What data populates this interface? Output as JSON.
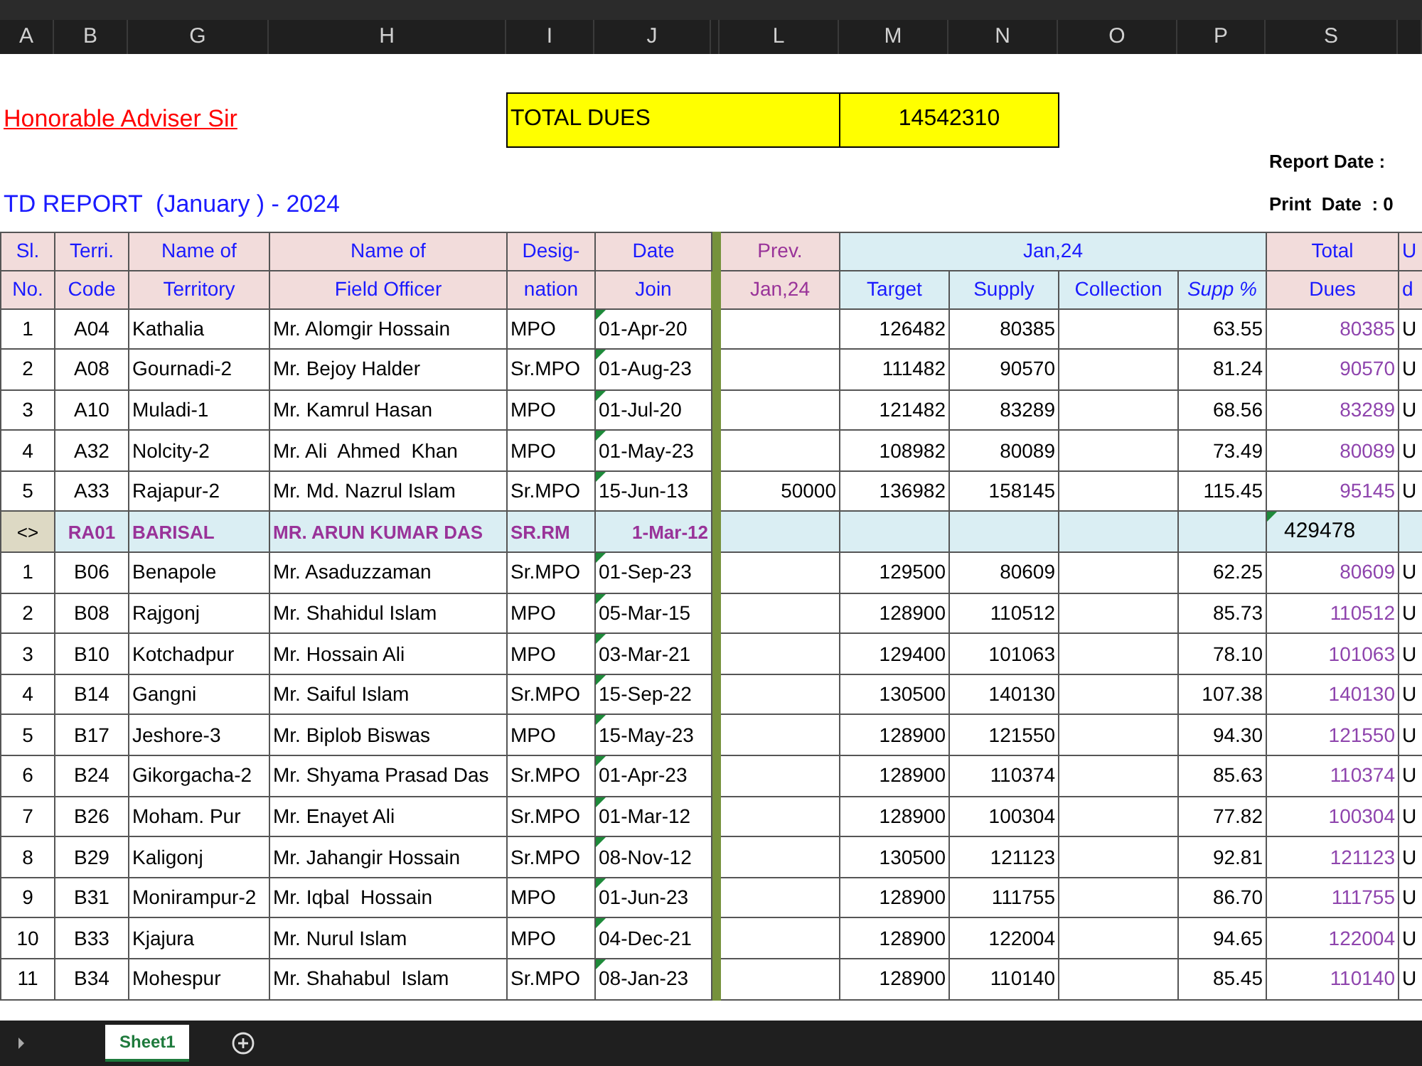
{
  "column_letters": [
    "A",
    "B",
    "G",
    "H",
    "I",
    "J",
    "L",
    "M",
    "N",
    "O",
    "P",
    "S"
  ],
  "top": {
    "adviser": "Honorable Adviser Sir",
    "total_dues_label": "TOTAL DUES",
    "total_dues_value": "14542310",
    "report_title": "TD REPORT  (January ) - 2024",
    "report_date": "Report Date :",
    "print_date": "Print  Date  : 0"
  },
  "header": {
    "sl": [
      "Sl.",
      "No."
    ],
    "code": [
      "Terri.",
      "Code"
    ],
    "territory": [
      "Name of",
      "Territory"
    ],
    "officer": [
      "Name of",
      "Field Officer"
    ],
    "designation": [
      "Desig-",
      "nation"
    ],
    "date_join": [
      "Date",
      "Join"
    ],
    "prev": [
      "Prev.",
      "Jan,24"
    ],
    "month": "Jan,24",
    "target": "Target",
    "supply": "Supply",
    "collection": "Collection",
    "supp_pct": "Supp %",
    "total_dues": [
      "Total",
      "Dues"
    ],
    "column_t": [
      "U",
      "d"
    ]
  },
  "rows": [
    {
      "kind": "data",
      "sl": "1",
      "code": "A04",
      "territory": "Kathalia",
      "officer": "Mr. Alomgir Hossain",
      "designation": "MPO",
      "date_join": "01-Apr-20",
      "prev": "",
      "target": "126482",
      "supply": "80385",
      "supp_pct": "63.55",
      "total_dues": "80385",
      "column_t": "U"
    },
    {
      "kind": "data",
      "sl": "2",
      "code": "A08",
      "territory": "Gournadi-2",
      "officer": "Mr. Bejoy Halder",
      "designation": "Sr.MPO",
      "date_join": "01-Aug-23",
      "prev": "",
      "target": "111482",
      "supply": "90570",
      "supp_pct": "81.24",
      "total_dues": "90570",
      "column_t": "U"
    },
    {
      "kind": "data",
      "sl": "3",
      "code": "A10",
      "territory": "Muladi-1",
      "officer": "Mr. Kamrul Hasan",
      "designation": "MPO",
      "date_join": "01-Jul-20",
      "prev": "",
      "target": "121482",
      "supply": "83289",
      "supp_pct": "68.56",
      "total_dues": "83289",
      "column_t": "U"
    },
    {
      "kind": "data",
      "sl": "4",
      "code": "A32",
      "territory": "Nolcity-2",
      "officer": "Mr. Ali  Ahmed  Khan",
      "designation": "MPO",
      "date_join": "01-May-23",
      "prev": "",
      "target": "108982",
      "supply": "80089",
      "supp_pct": "73.49",
      "total_dues": "80089",
      "column_t": "U"
    },
    {
      "kind": "data",
      "sl": "5",
      "code": "A33",
      "territory": "Rajapur-2",
      "officer": "Mr. Md. Nazrul Islam",
      "designation": "Sr.MPO",
      "date_join": "15-Jun-13",
      "prev": "50000",
      "target": "136982",
      "supply": "158145",
      "supp_pct": "115.45",
      "total_dues": "95145",
      "column_t": "U"
    },
    {
      "kind": "group",
      "sl": "<>",
      "code": "RA01",
      "territory": "BARISAL",
      "officer": "MR. ARUN KUMAR DAS",
      "designation": "SR.RM",
      "date_join": "1-Mar-12",
      "total_dues": "429478"
    },
    {
      "kind": "data",
      "sl": "1",
      "code": "B06",
      "territory": "Benapole",
      "officer": "Mr. Asaduzzaman",
      "designation": "Sr.MPO",
      "date_join": "01-Sep-23",
      "prev": "",
      "target": "129500",
      "supply": "80609",
      "supp_pct": "62.25",
      "total_dues": "80609",
      "column_t": "U"
    },
    {
      "kind": "data",
      "sl": "2",
      "code": "B08",
      "territory": "Rajgonj",
      "officer": "Mr. Shahidul Islam",
      "designation": "MPO",
      "date_join": "05-Mar-15",
      "prev": "",
      "target": "128900",
      "supply": "110512",
      "supp_pct": "85.73",
      "total_dues": "110512",
      "column_t": "U"
    },
    {
      "kind": "data",
      "sl": "3",
      "code": "B10",
      "territory": "Kotchadpur",
      "officer": "Mr. Hossain Ali",
      "designation": "MPO",
      "date_join": "03-Mar-21",
      "prev": "",
      "target": "129400",
      "supply": "101063",
      "supp_pct": "78.10",
      "total_dues": "101063",
      "column_t": "U"
    },
    {
      "kind": "data",
      "sl": "4",
      "code": "B14",
      "territory": "Gangni",
      "officer": "Mr. Saiful Islam",
      "designation": "Sr.MPO",
      "date_join": "15-Sep-22",
      "prev": "",
      "target": "130500",
      "supply": "140130",
      "supp_pct": "107.38",
      "total_dues": "140130",
      "column_t": "U"
    },
    {
      "kind": "data",
      "sl": "5",
      "code": "B17",
      "territory": "Jeshore-3",
      "officer": "Mr. Biplob Biswas",
      "designation": "MPO",
      "date_join": "15-May-23",
      "prev": "",
      "target": "128900",
      "supply": "121550",
      "supp_pct": "94.30",
      "total_dues": "121550",
      "column_t": "U"
    },
    {
      "kind": "data",
      "sl": "6",
      "code": "B24",
      "territory": "Gikorgacha-2",
      "officer": "Mr. Shyama Prasad Das",
      "designation": "Sr.MPO",
      "date_join": "01-Apr-23",
      "prev": "",
      "target": "128900",
      "supply": "110374",
      "supp_pct": "85.63",
      "total_dues": "110374",
      "column_t": "U"
    },
    {
      "kind": "data",
      "sl": "7",
      "code": "B26",
      "territory": "Moham. Pur",
      "officer": "Mr. Enayet Ali",
      "designation": "Sr.MPO",
      "date_join": "01-Mar-12",
      "prev": "",
      "target": "128900",
      "supply": "100304",
      "supp_pct": "77.82",
      "total_dues": "100304",
      "column_t": "U"
    },
    {
      "kind": "data",
      "sl": "8",
      "code": "B29",
      "territory": "Kaligonj",
      "officer": "Mr. Jahangir Hossain",
      "designation": "Sr.MPO",
      "date_join": "08-Nov-12",
      "prev": "",
      "target": "130500",
      "supply": "121123",
      "supp_pct": "92.81",
      "total_dues": "121123",
      "column_t": "U"
    },
    {
      "kind": "data",
      "sl": "9",
      "code": "B31",
      "territory": "Monirampur-2",
      "officer": "Mr. Iqbal  Hossain",
      "designation": "MPO",
      "date_join": "01-Jun-23",
      "prev": "",
      "target": "128900",
      "supply": "111755",
      "supp_pct": "86.70",
      "total_dues": "111755",
      "column_t": "U"
    },
    {
      "kind": "data",
      "sl": "10",
      "code": "B33",
      "territory": "Kjajura",
      "officer": "Mr. Nurul Islam",
      "designation": "MPO",
      "date_join": "04-Dec-21",
      "prev": "",
      "target": "128900",
      "supply": "122004",
      "supp_pct": "94.65",
      "total_dues": "122004",
      "column_t": "U"
    },
    {
      "kind": "data",
      "sl": "11",
      "code": "B34",
      "territory": "Mohespur",
      "officer": "Mr. Shahabul  Islam",
      "designation": "Sr.MPO",
      "date_join": "08-Jan-23",
      "prev": "",
      "target": "128900",
      "supply": "110140",
      "supp_pct": "85.45",
      "total_dues": "110140",
      "column_t": "U"
    }
  ],
  "sheet_tabs": [
    {
      "label": "Sheet1",
      "selected": true
    }
  ]
}
